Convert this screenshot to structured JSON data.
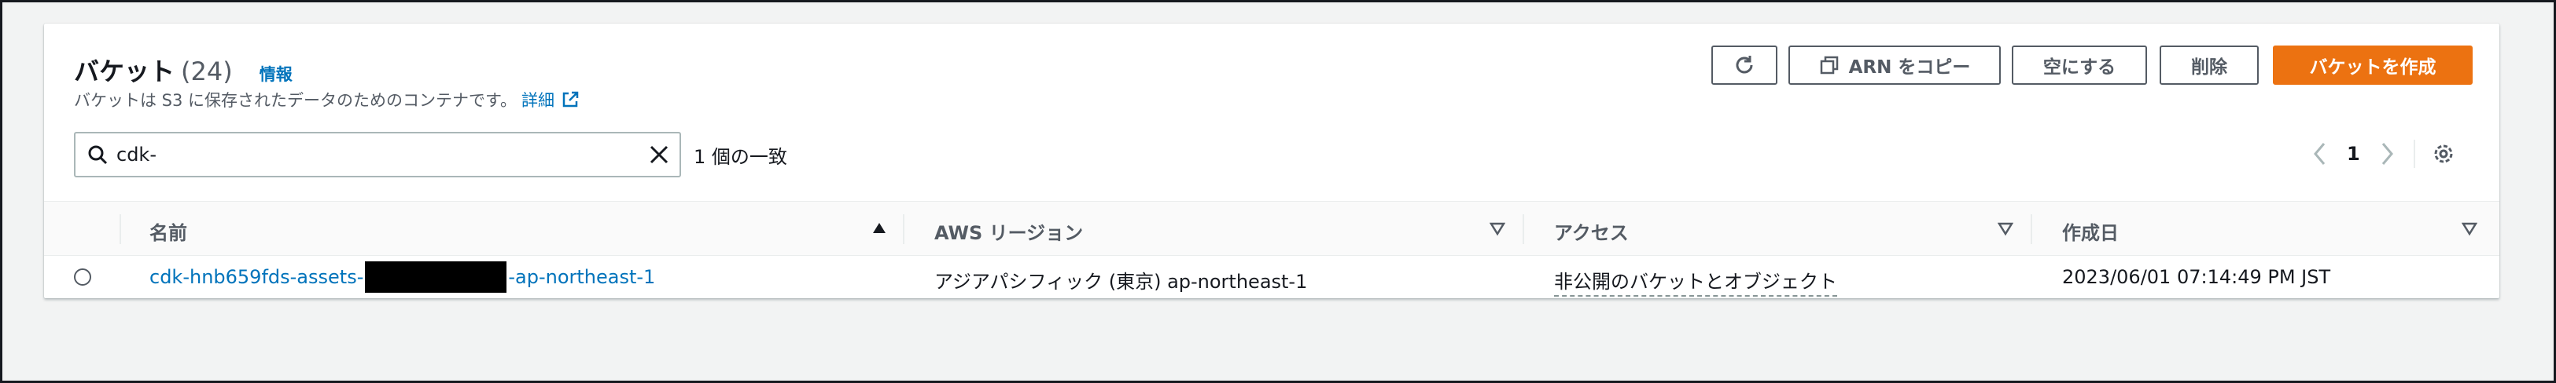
{
  "header": {
    "title": "バケット",
    "count": "(24)",
    "info_link": "情報",
    "description": "バケットは S3 に保存されたデータのためのコンテナです。",
    "details_link": "詳細"
  },
  "actions": {
    "refresh_icon": "refresh-icon",
    "copy_arn": "ARN をコピー",
    "empty": "空にする",
    "delete": "削除",
    "create": "バケットを作成"
  },
  "search": {
    "value": "cdk-",
    "match_text": "1 個の一致"
  },
  "pagination": {
    "current_page": "1"
  },
  "table": {
    "columns": [
      "名前",
      "AWS リージョン",
      "アクセス",
      "作成日"
    ],
    "rows": [
      {
        "name_prefix": "cdk-hnb659fds-assets-",
        "name_suffix": "-ap-northeast-1",
        "region": "アジアパシフィック (東京) ap-northeast-1",
        "access": "非公開のバケットとオブジェクト",
        "created": "2023/06/01 07:14:49 PM JST"
      }
    ]
  },
  "colors": {
    "primary": "#ec7211",
    "link": "#0073bb",
    "text_secondary": "#545b64"
  }
}
